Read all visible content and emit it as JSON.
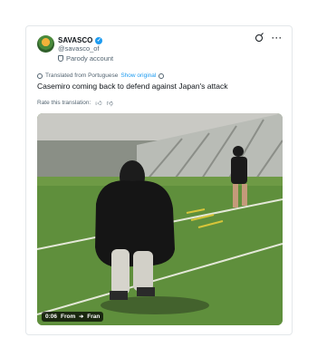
{
  "author": {
    "name": "SAVASCO",
    "handle": "@savasco_of",
    "parody_label": "Parody account"
  },
  "translation": {
    "notice": "Translated from Portuguese",
    "show_original": "Show original"
  },
  "tweet": {
    "text": "Casemiro coming back to defend against Japan's attack"
  },
  "rate": {
    "label": "Rate this translation:"
  },
  "video": {
    "time": "0:06",
    "from_label": "From",
    "from_source": "Fran"
  },
  "icons": {
    "verified": "verified-badge-icon",
    "grok": "grok-icon",
    "more": "more-icon",
    "parody": "parody-mask-icon",
    "globe": "globe-icon",
    "settings": "translation-settings-icon",
    "thumbs_up": "thumbs-up-icon",
    "thumbs_down": "thumbs-down-icon"
  },
  "colors": {
    "accent": "#1d9bf0",
    "secondary_text": "#536471"
  }
}
